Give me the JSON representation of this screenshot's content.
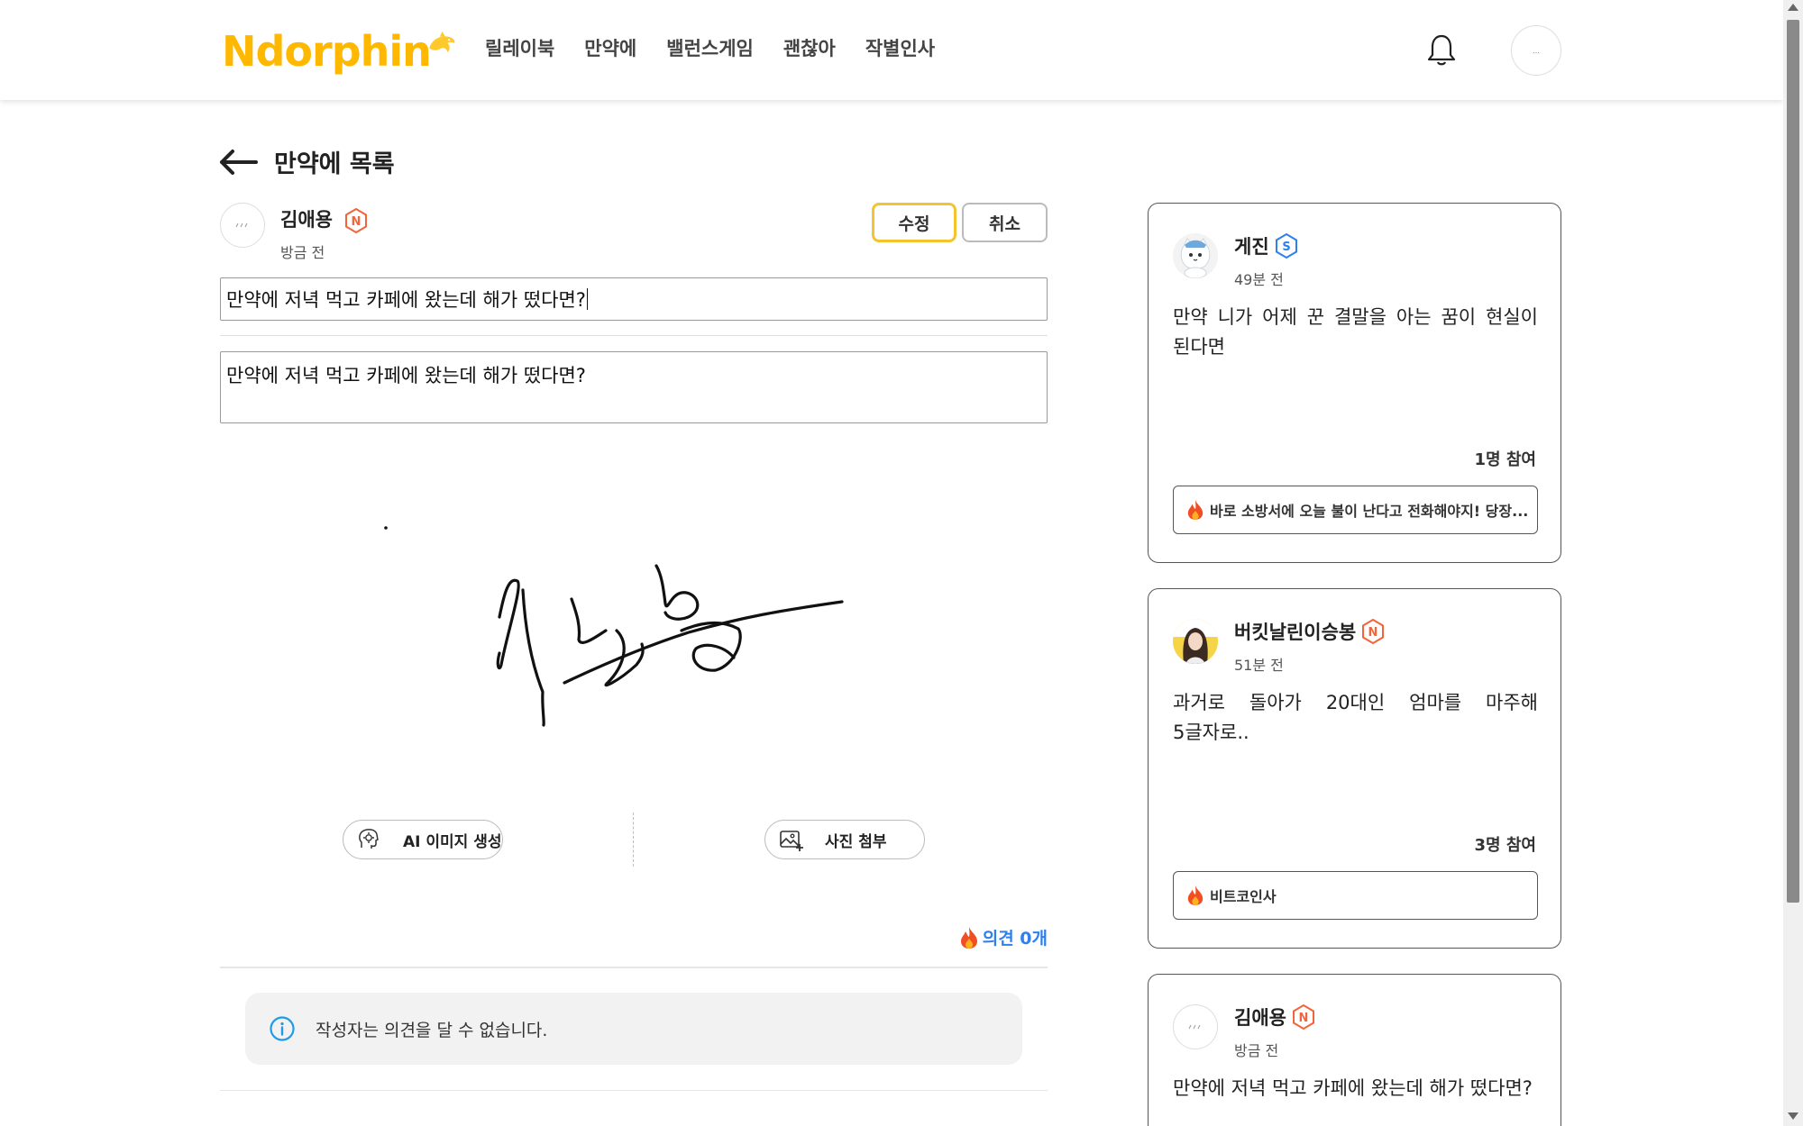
{
  "header": {
    "logo": "Ndorphin",
    "nav": [
      "릴레이북",
      "만약에",
      "밸런스게임",
      "괜찮아",
      "작별인사"
    ],
    "avatar_text": "..."
  },
  "page": {
    "back_title": "만약에 목록"
  },
  "post": {
    "author": "김애용",
    "time": "방금 전",
    "edit_label": "수정",
    "cancel_label": "취소",
    "title_value": "만약에 저녁 먹고 카페에 왔는데 해가 떴다면?",
    "content_value": "만약에 저녁 먹고 카페에 왔는데 해가 떴다면?",
    "ai_image_label": "AI 이미지 생성",
    "photo_label": "사진 첨부",
    "opinion_label": "의견 0개",
    "notice": "작성자는 의견을 달 수 없습니다."
  },
  "cards": [
    {
      "name": "게진",
      "badge": "S",
      "time": "49분 전",
      "text": "만약 니가 어제 꾼 결말을 아는 꿈이 현실이 된다면",
      "count": "1명 참여",
      "reply": "바로 소방서에 오늘 불이 난다고 전화해야지! 당장..."
    },
    {
      "name": "버킷날린이승봉",
      "badge": "N",
      "time": "51분 전",
      "text": "과거로 돌아가 20대인 엄마를 마주해 5글자로..",
      "count": "3명 참여",
      "reply": "비트코인사"
    },
    {
      "name": "김애용",
      "badge": "N",
      "time": "방금 전",
      "text": "만약에 저녁 먹고 카페에 왔는데 해가 떴다면?"
    }
  ],
  "colors": {
    "brand": "#FFC82C",
    "accent_border": "#F4C430",
    "opinion_blue": "#2F80ED",
    "badge_n": "#F2653A",
    "badge_s": "#2F80ED"
  }
}
